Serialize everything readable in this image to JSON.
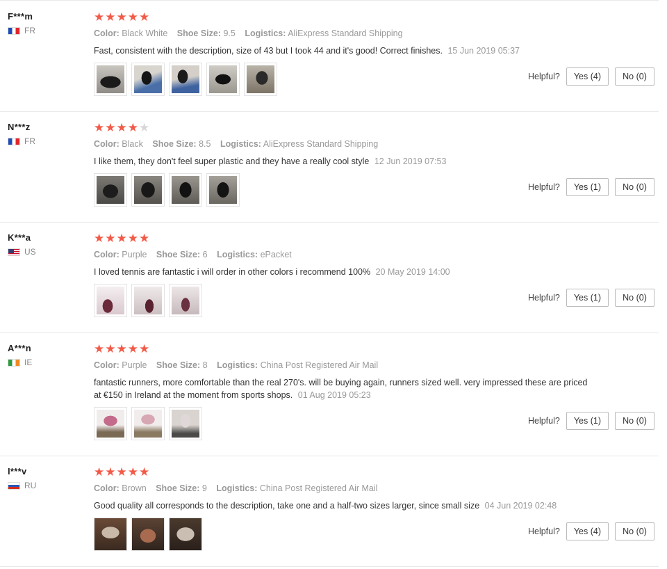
{
  "labels": {
    "color": "Color:",
    "shoe_size": "Shoe Size:",
    "logistics": "Logistics:",
    "helpful": "Helpful?"
  },
  "colors": {
    "star_on": "#f25a48",
    "star_off": "#d7d7d7"
  },
  "reviews": [
    {
      "user": "F***m",
      "country": "FR",
      "rating": 5,
      "color": "Black White",
      "size": "9.5",
      "logistics": "AliExpress Standard Shipping",
      "text": "Fast, consistent with the description, size of 43 but I took 44 and it's good! Correct finishes.",
      "date": "15 Jun 2019 05:37",
      "photo_count": 5,
      "yes": "Yes (4)",
      "no": "No (0)"
    },
    {
      "user": "N***z",
      "country": "FR",
      "rating": 4,
      "color": "Black",
      "size": "8.5",
      "logistics": "AliExpress Standard Shipping",
      "text": "I like them, they don't feel super plastic and they have a really cool style",
      "date": "12 Jun 2019 07:53",
      "photo_count": 4,
      "yes": "Yes (1)",
      "no": "No (0)"
    },
    {
      "user": "K***a",
      "country": "US",
      "rating": 5,
      "color": "Purple",
      "size": "6",
      "logistics": "ePacket",
      "text": "I loved tennis are fantastic i will order in other colors i recommend 100%",
      "date": "20 May 2019 14:00",
      "photo_count": 3,
      "yes": "Yes (1)",
      "no": "No (0)"
    },
    {
      "user": "A***n",
      "country": "IE",
      "rating": 5,
      "color": "Purple",
      "size": "8",
      "logistics": "China Post Registered Air Mail",
      "text": "fantastic runners, more comfortable than the real 270's. will be buying again, runners sized well. very impressed these are priced at €150 in Ireland at the moment from sports shops.",
      "date": "01 Aug 2019 05:23",
      "photo_count": 3,
      "yes": "Yes (1)",
      "no": "No (0)"
    },
    {
      "user": "I***v",
      "country": "RU",
      "rating": 5,
      "color": "Brown",
      "size": "9",
      "logistics": "China Post Registered Air Mail",
      "text": "Good quality all corresponds to the description, take one and a half-two sizes larger, since small size",
      "date": "04 Jun 2019 02:48",
      "photo_count": 3,
      "yes": "Yes (4)",
      "no": "No (0)"
    }
  ]
}
